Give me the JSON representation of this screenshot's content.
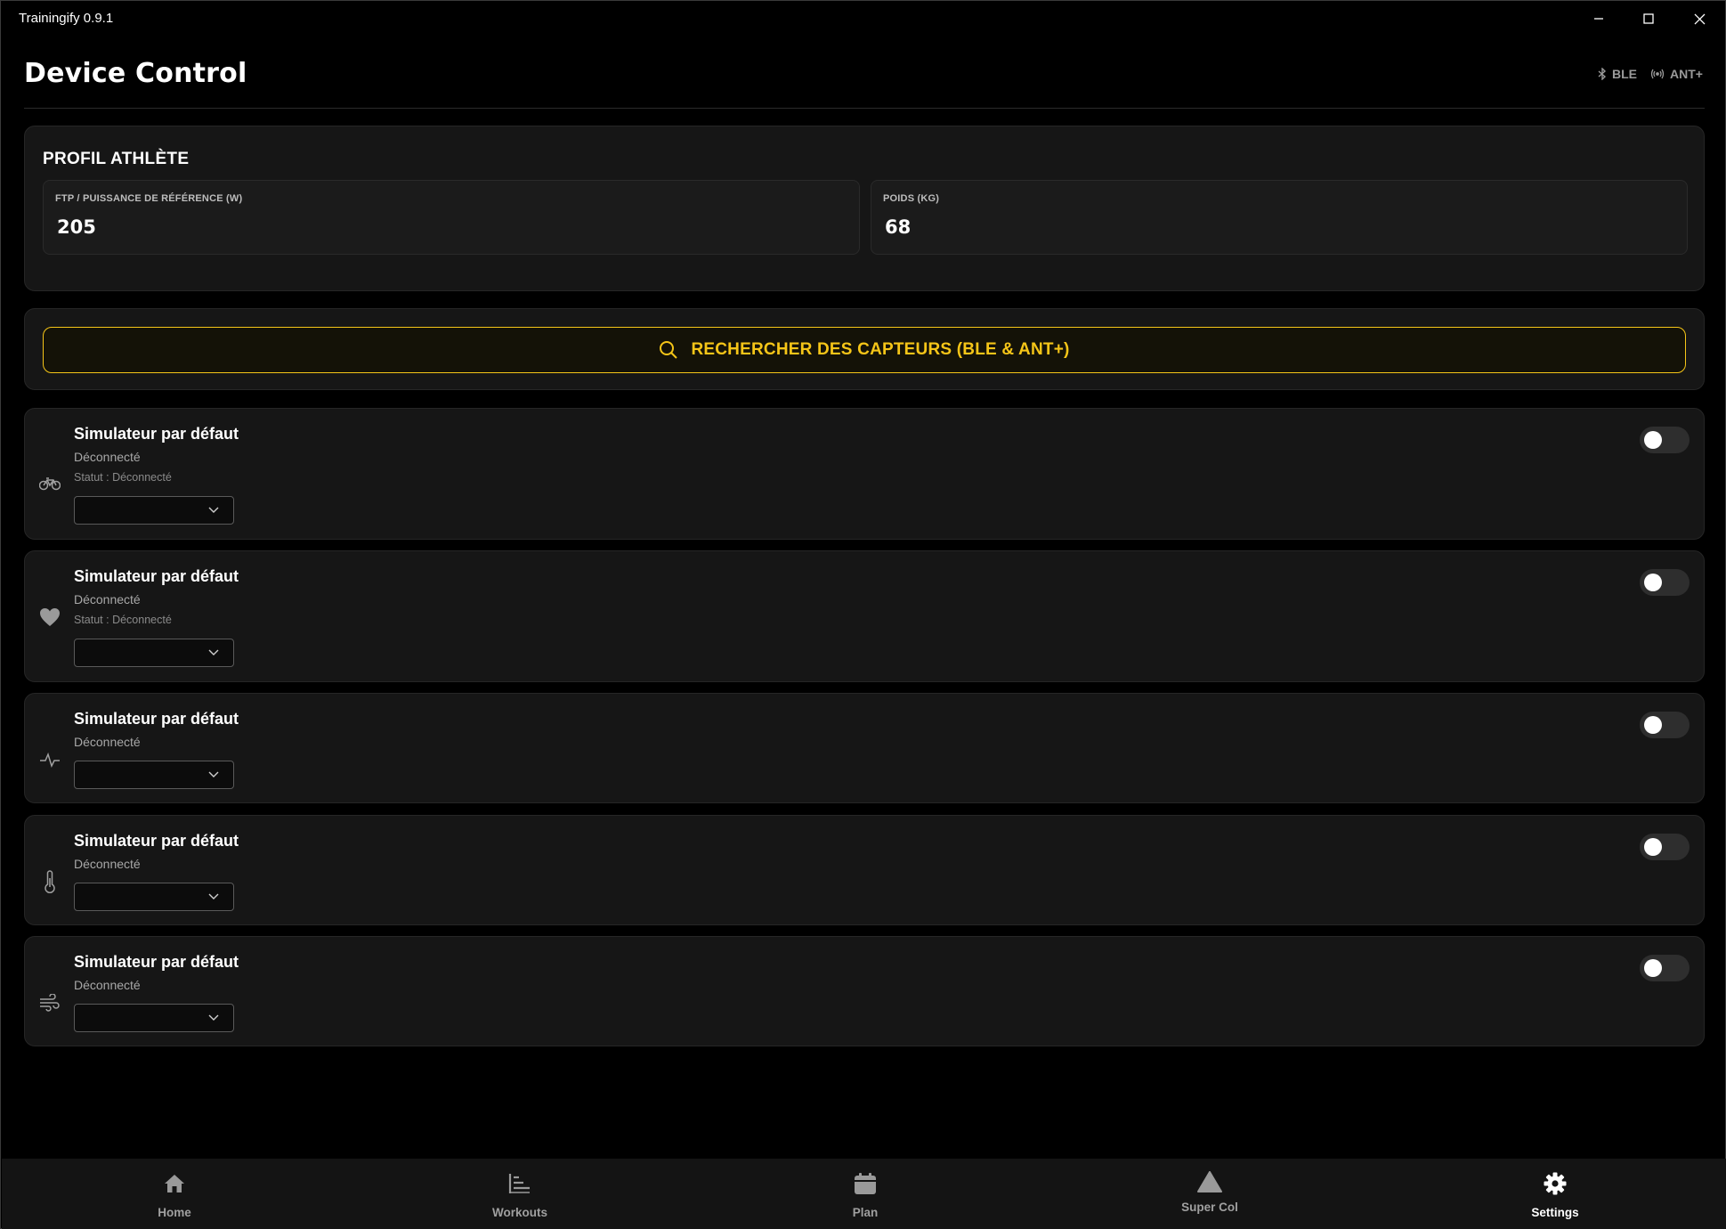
{
  "window": {
    "title": "Trainingify 0.9.1"
  },
  "header": {
    "title": "Device Control",
    "connections": [
      {
        "label": "BLE",
        "icon": "bluetooth-icon"
      },
      {
        "label": "ANT+",
        "icon": "antenna-icon"
      }
    ]
  },
  "profile": {
    "title": "PROFIL ATHLÈTE",
    "ftp": {
      "label": "FTP / PUISSANCE DE RÉFÉRENCE (W)",
      "value": "205"
    },
    "weight": {
      "label": "POIDS (KG)",
      "value": "68"
    }
  },
  "scan": {
    "label": "RECHERCHER DES CAPTEURS (BLE & ANT+)",
    "icon": "search-icon"
  },
  "sensors": [
    {
      "icon": "bike-icon",
      "name": "Simulateur par défaut",
      "state": "Déconnecté",
      "status": "Statut : Déconnecté",
      "enabled": false,
      "selected": ""
    },
    {
      "icon": "heart-icon",
      "name": "Simulateur par défaut",
      "state": "Déconnecté",
      "status": "Statut : Déconnecté",
      "enabled": false,
      "selected": ""
    },
    {
      "icon": "pulse-icon",
      "name": "Simulateur par défaut",
      "state": "Déconnecté",
      "enabled": false,
      "selected": ""
    },
    {
      "icon": "thermometer-icon",
      "name": "Simulateur par défaut",
      "state": "Déconnecté",
      "enabled": false,
      "selected": ""
    },
    {
      "icon": "wind-icon",
      "name": "Simulateur par défaut",
      "state": "Déconnecté",
      "enabled": false,
      "selected": ""
    }
  ],
  "nav": {
    "items": [
      {
        "label": "Home",
        "icon": "home-icon"
      },
      {
        "label": "Workouts",
        "icon": "workouts-icon"
      },
      {
        "label": "Plan",
        "icon": "calendar-icon"
      },
      {
        "label": "Super Col",
        "icon": "mountain-icon"
      },
      {
        "label": "Settings",
        "icon": "gear-icon"
      }
    ],
    "active": "Settings"
  },
  "colors": {
    "accent": "#f5c518",
    "background": "#000000",
    "card": "#161616"
  }
}
